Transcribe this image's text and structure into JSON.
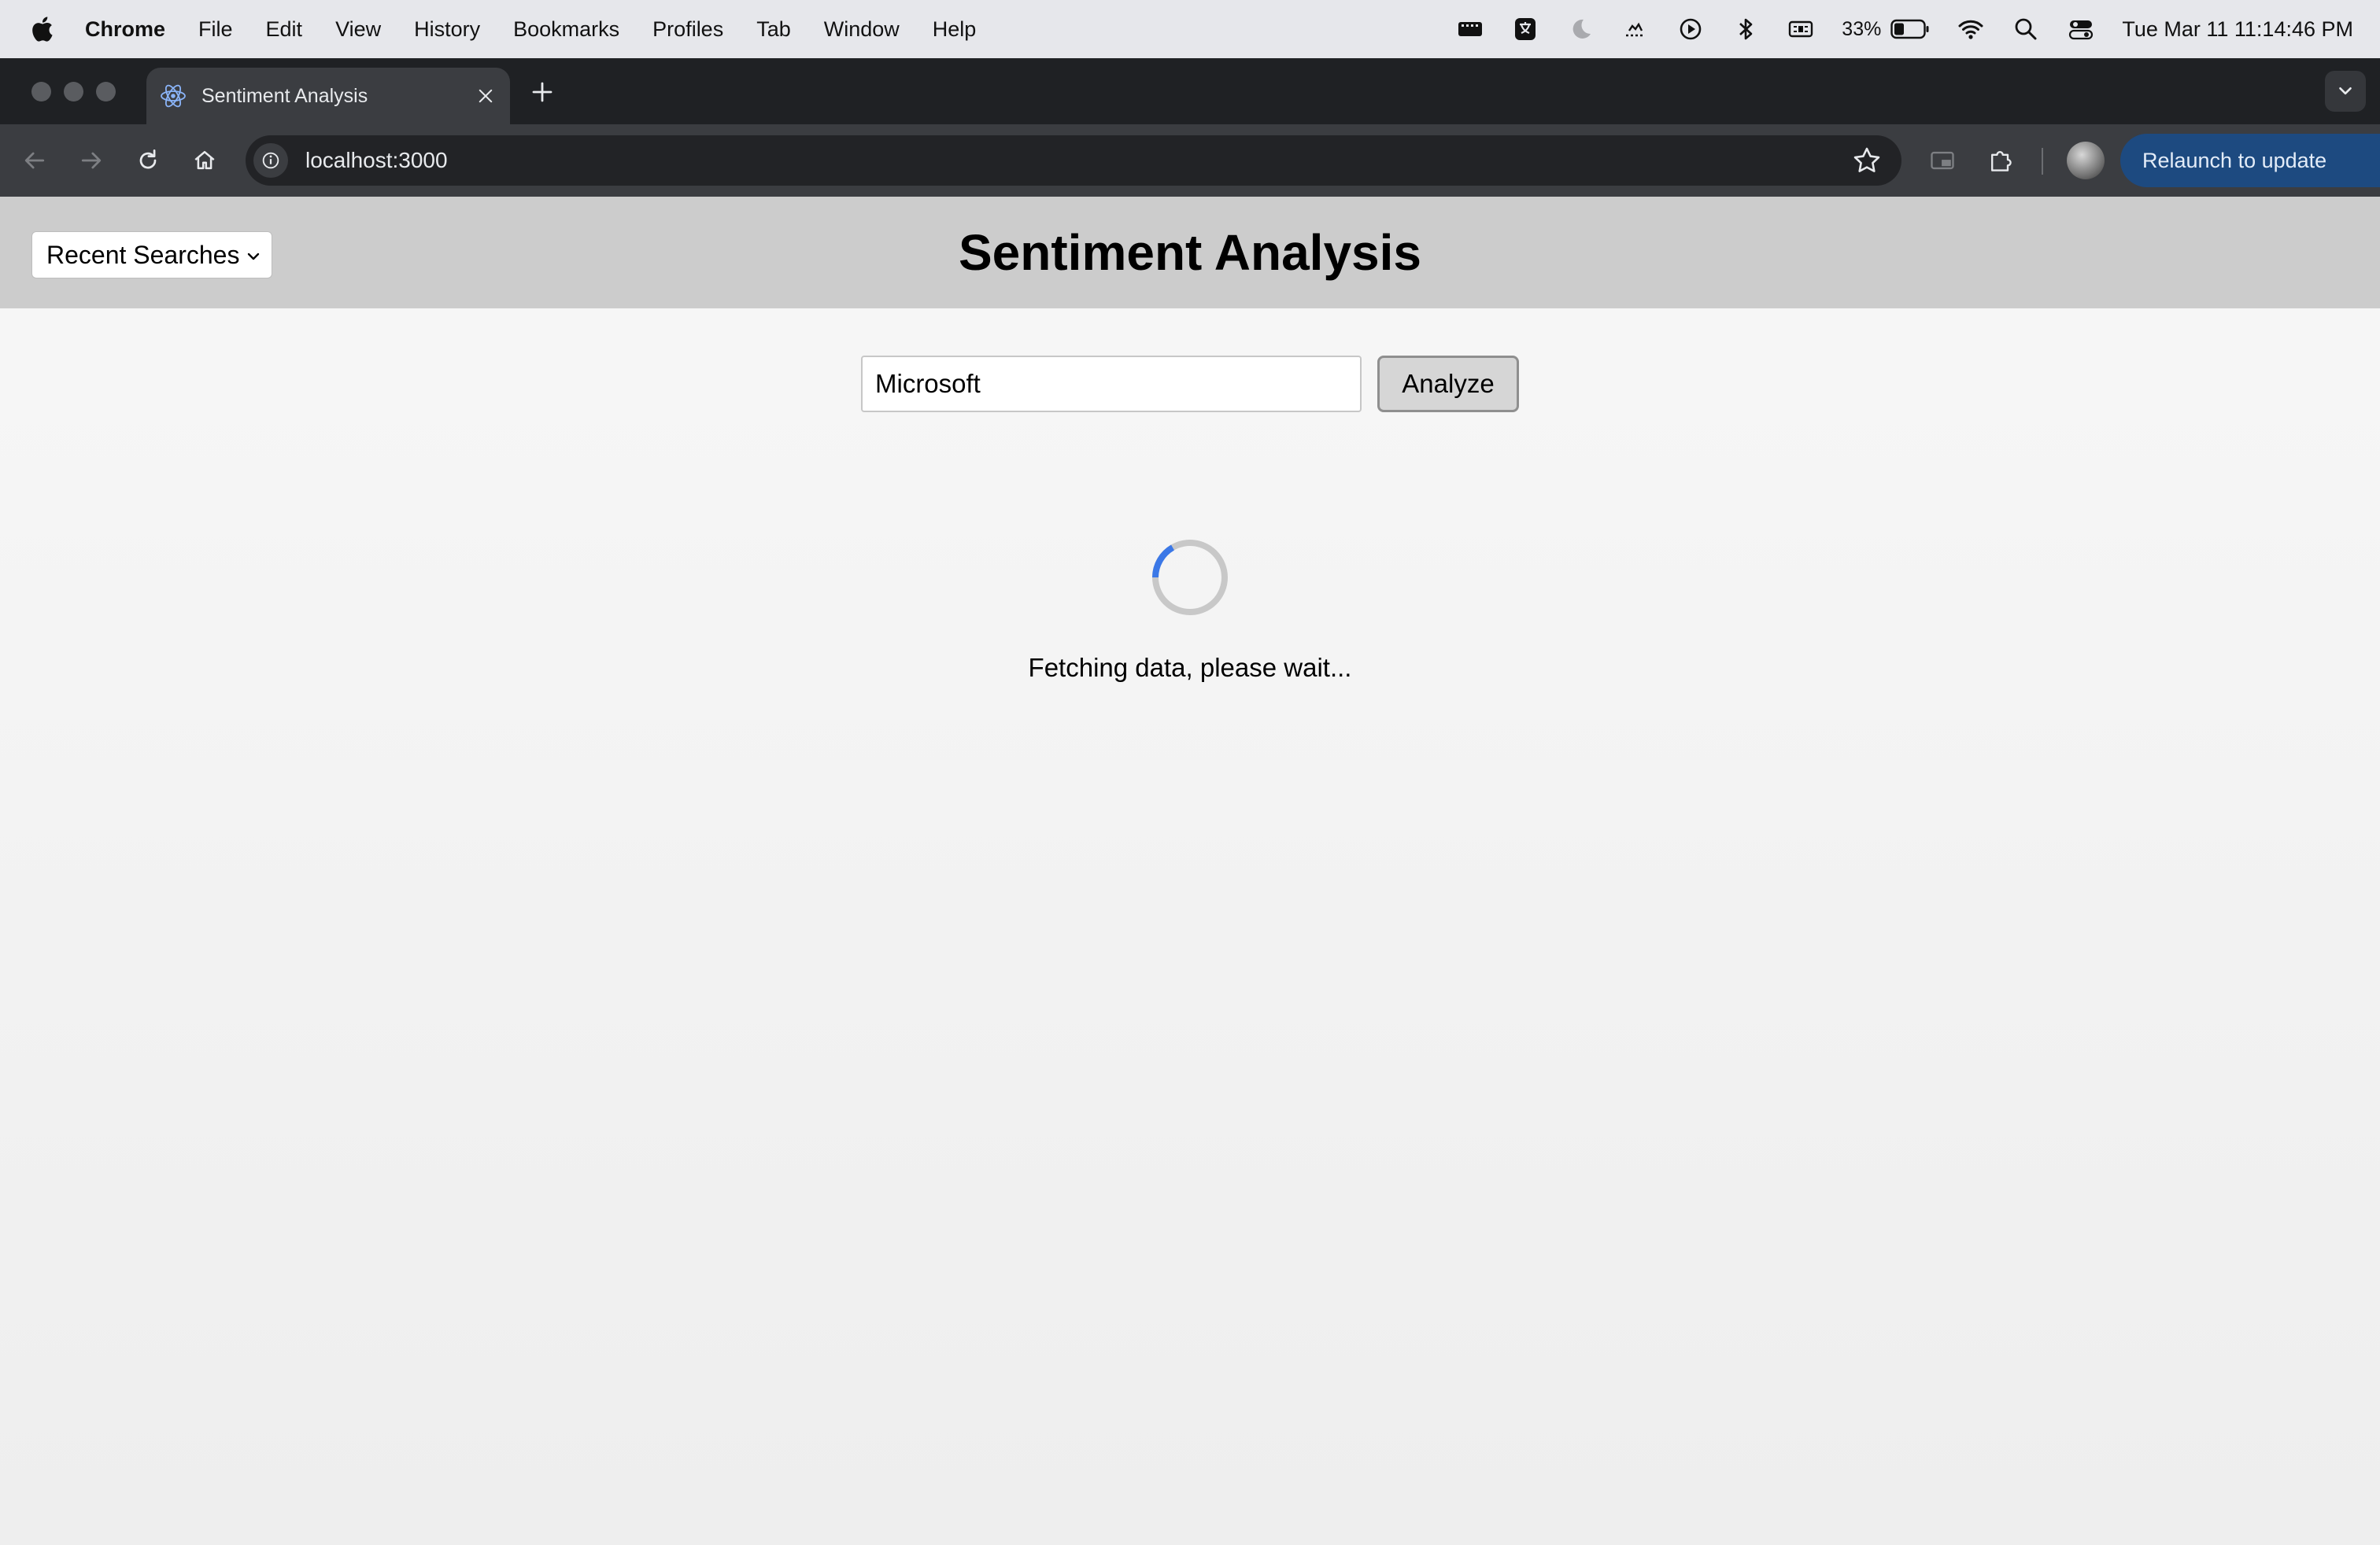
{
  "menubar": {
    "app_name": "Chrome",
    "items": [
      "File",
      "Edit",
      "View",
      "History",
      "Bookmarks",
      "Profiles",
      "Tab",
      "Window",
      "Help"
    ],
    "battery_percent": "33%",
    "clock": "Tue Mar 11  11:14:46 PM"
  },
  "browser": {
    "tab_title": "Sentiment Analysis",
    "url": "localhost:3000",
    "relaunch_label": "Relaunch to update"
  },
  "app": {
    "recent_searches_label": "Recent Searches",
    "title": "Sentiment Analysis",
    "search_value": "Microsoft",
    "analyze_label": "Analyze",
    "loading_text": "Fetching data, please wait..."
  },
  "colors": {
    "header_bg": "#cccccc",
    "spinner_accent": "#3b78e7",
    "relaunch_bg": "#1d4a80"
  }
}
